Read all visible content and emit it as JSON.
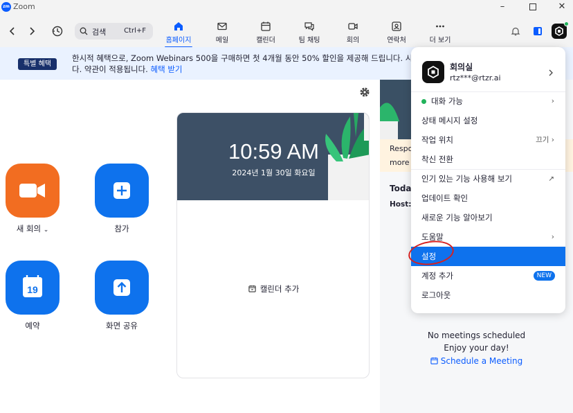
{
  "app": {
    "logo": "zm",
    "title": "Zoom"
  },
  "search": {
    "label": "검색",
    "shortcut": "Ctrl+F"
  },
  "tabs": [
    {
      "label": "홈페이지",
      "icon": "home-icon",
      "active": true
    },
    {
      "label": "메일",
      "icon": "mail-icon"
    },
    {
      "label": "캘린더",
      "icon": "calendar-icon"
    },
    {
      "label": "팀 채팅",
      "icon": "chat-icon"
    },
    {
      "label": "회의",
      "icon": "video-icon"
    },
    {
      "label": "연락처",
      "icon": "contacts-icon"
    },
    {
      "label": "더 보기",
      "icon": "more-icon"
    }
  ],
  "banner": {
    "badge": "특별 혜택",
    "text": "한시적 혜택으로, Zoom Webinars 500을 구매하면 첫 4개월 동안 50% 할인을 제공해 드립니다. 시",
    "text2": "다. 약관이 적용됩니다.",
    "link": "혜택 받기"
  },
  "actions": [
    {
      "label": "새 회의",
      "icon": "video-camera-icon"
    },
    {
      "label": "참가",
      "icon": "plus-icon"
    },
    {
      "label": "예약",
      "icon": "calendar-19-icon",
      "day": "19"
    },
    {
      "label": "화면 공유",
      "icon": "share-arrow-icon"
    }
  ],
  "clock": {
    "time": "10:59 AM",
    "date": "2024년 1월 30일 화요일",
    "add_calendar": "캘린더 추가"
  },
  "right_panel": {
    "notice_line1": "Respo",
    "notice_line2": "more",
    "today": "Today",
    "host": "Host:",
    "empty_line1": "No meetings scheduled",
    "empty_line2": "Enjoy your day!",
    "schedule_link": "Schedule a Meeting"
  },
  "menu": {
    "name": "회의실",
    "email": "rtz***@rtzr.ai",
    "status": "대화 가능",
    "items": {
      "status_message": "상태 메시지 설정",
      "work_location": "작업 위치",
      "work_location_value": "끄기",
      "focus": "착신 전환",
      "popular": "인기 있는 기능 사용해 보기",
      "update": "업데이트 확인",
      "new_features": "새로운 기능 알아보기",
      "help": "도움말",
      "settings": "설정",
      "add_account": "계정 추가",
      "new_badge": "NEW",
      "logout": "로그아웃"
    }
  },
  "colors": {
    "accent": "#0b5cff",
    "orange": "#f26d21",
    "blue": "#0e72ed",
    "highlight": "#0e72ed",
    "annotation": "#d62020"
  }
}
